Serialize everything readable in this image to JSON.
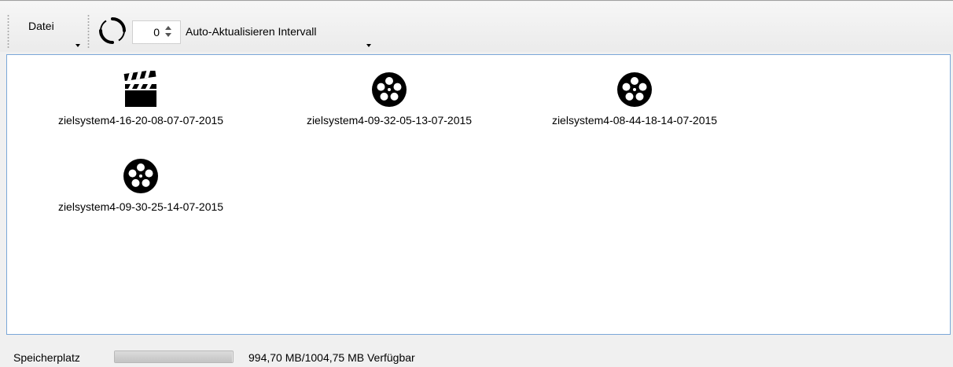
{
  "toolbar": {
    "file_menu_label": "Datei",
    "interval_value": "0",
    "interval_label": "Auto-Aktualisieren Intervall"
  },
  "files": [
    {
      "label": "zielsystem4-16-20-08-07-07-2015",
      "icon": "clapperboard-icon"
    },
    {
      "label": "zielsystem4-09-32-05-13-07-2015",
      "icon": "film-reel-icon"
    },
    {
      "label": "zielsystem4-08-44-18-14-07-2015",
      "icon": "film-reel-icon"
    },
    {
      "label": "zielsystem4-09-30-25-14-07-2015",
      "icon": "film-reel-icon"
    }
  ],
  "status": {
    "storage_label": "Speicherplatz",
    "storage_text": "994,70 MB/1004,75 MB Verfügbar",
    "storage_available_fraction": 0.99
  },
  "colors": {
    "content_border": "#7aa7d8",
    "icon": "#000000"
  }
}
